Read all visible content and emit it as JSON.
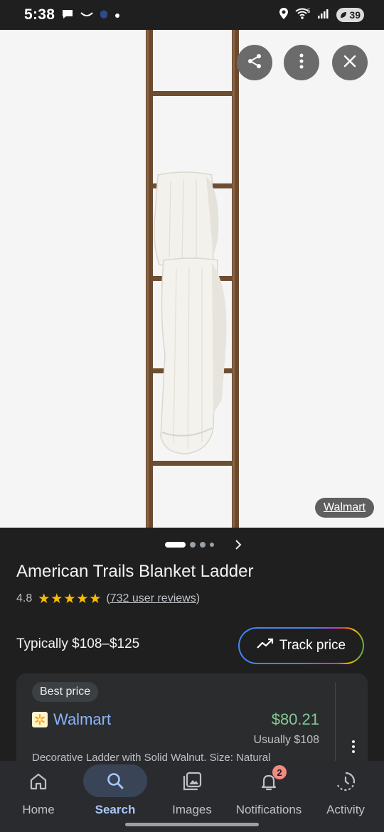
{
  "status_bar": {
    "time": "5:38",
    "battery": "39",
    "icons": [
      "message-icon",
      "smile-icon",
      "shield-icon",
      "dot-icon",
      "location-icon",
      "wifi-icon",
      "signal-icon",
      "battery-icon"
    ]
  },
  "hero": {
    "source_label": "Walmart",
    "actions": [
      "share-icon",
      "more-vert-icon",
      "close-icon"
    ]
  },
  "pager": {
    "pages": 4,
    "current": 1
  },
  "product": {
    "title": "American Trails Blanket Ladder",
    "rating": "4.8",
    "stars": "★★★★★",
    "reviews_text": "732 user reviews",
    "typical_price": "Typically $108–$125",
    "track_label": "Track price"
  },
  "offer": {
    "badge": "Best price",
    "merchant": "Walmart",
    "price": "$80.21",
    "usually": "Usually $108",
    "description": "Decorative Ladder with Solid Walnut, Size: Natural"
  },
  "bottom_nav": [
    {
      "label": "Home",
      "icon": "home-icon"
    },
    {
      "label": "Search",
      "icon": "search-icon"
    },
    {
      "label": "Images",
      "icon": "images-icon"
    },
    {
      "label": "Notifications",
      "icon": "bell-icon",
      "badge": "2"
    },
    {
      "label": "Activity",
      "icon": "activity-icon"
    }
  ],
  "colors": {
    "accent_blue": "#8ab4f8",
    "price_green": "#81c995",
    "star_yellow": "#fbbc04",
    "nav_active": "#a8c7fa"
  }
}
